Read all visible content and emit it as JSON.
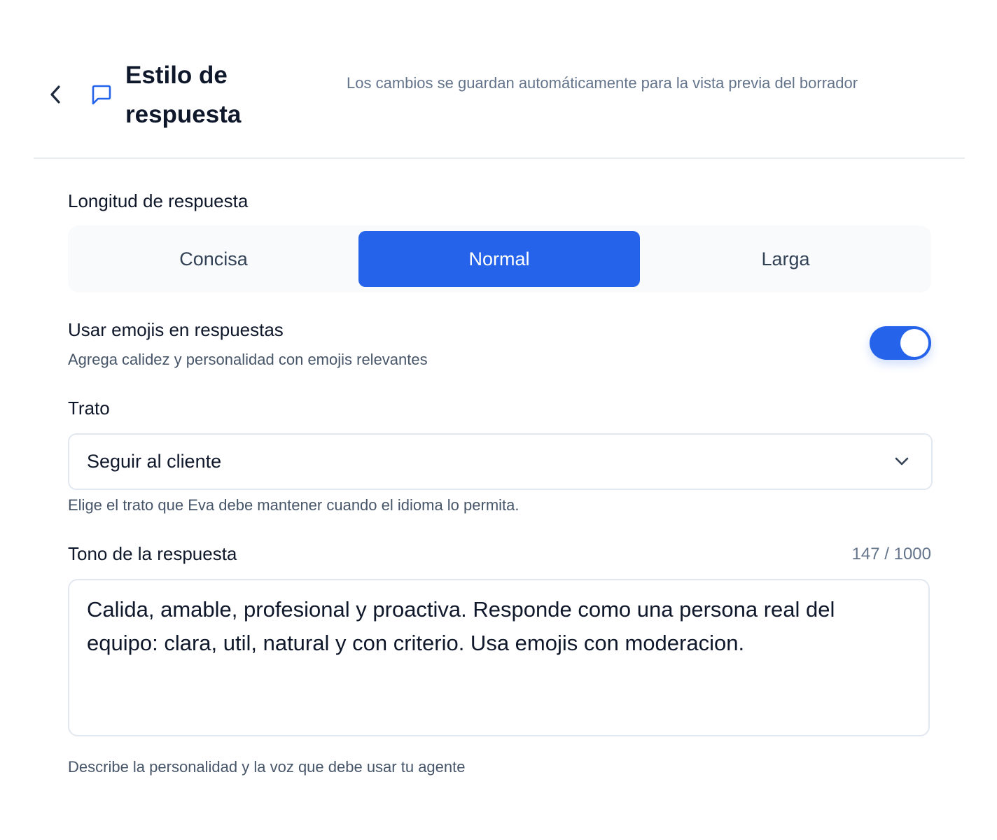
{
  "header": {
    "title": "Estilo de respuesta",
    "autosave_note": "Los cambios se guardan automáticamente para la vista previa del borrador",
    "back_icon": "chevron-left-icon",
    "title_icon": "message-square-icon"
  },
  "length": {
    "label": "Longitud de respuesta",
    "options": [
      "Concisa",
      "Normal",
      "Larga"
    ],
    "selected": "Normal"
  },
  "emojis": {
    "label": "Usar emojis en respuestas",
    "description": "Agrega calidez y personalidad con emojis relevantes",
    "enabled": true
  },
  "treatment": {
    "label": "Trato",
    "value": "Seguir al cliente",
    "help": "Elige el trato que Eva debe mantener cuando el idioma lo permita.",
    "chevron_icon": "chevron-down-icon"
  },
  "tone": {
    "label": "Tono de la respuesta",
    "char_count": "147 / 1000",
    "value": "Calida, amable, profesional y proactiva. Responde como una persona real del equipo: clara, util, natural y con criterio. Usa emojis con moderacion.",
    "help": "Describe la personalidad y la voz que debe usar tu agente"
  },
  "colors": {
    "accent": "#2563eb",
    "text": "#0f172a",
    "muted": "#64748b",
    "border": "#e2e8f0",
    "segment_bg": "#f8fafc"
  }
}
